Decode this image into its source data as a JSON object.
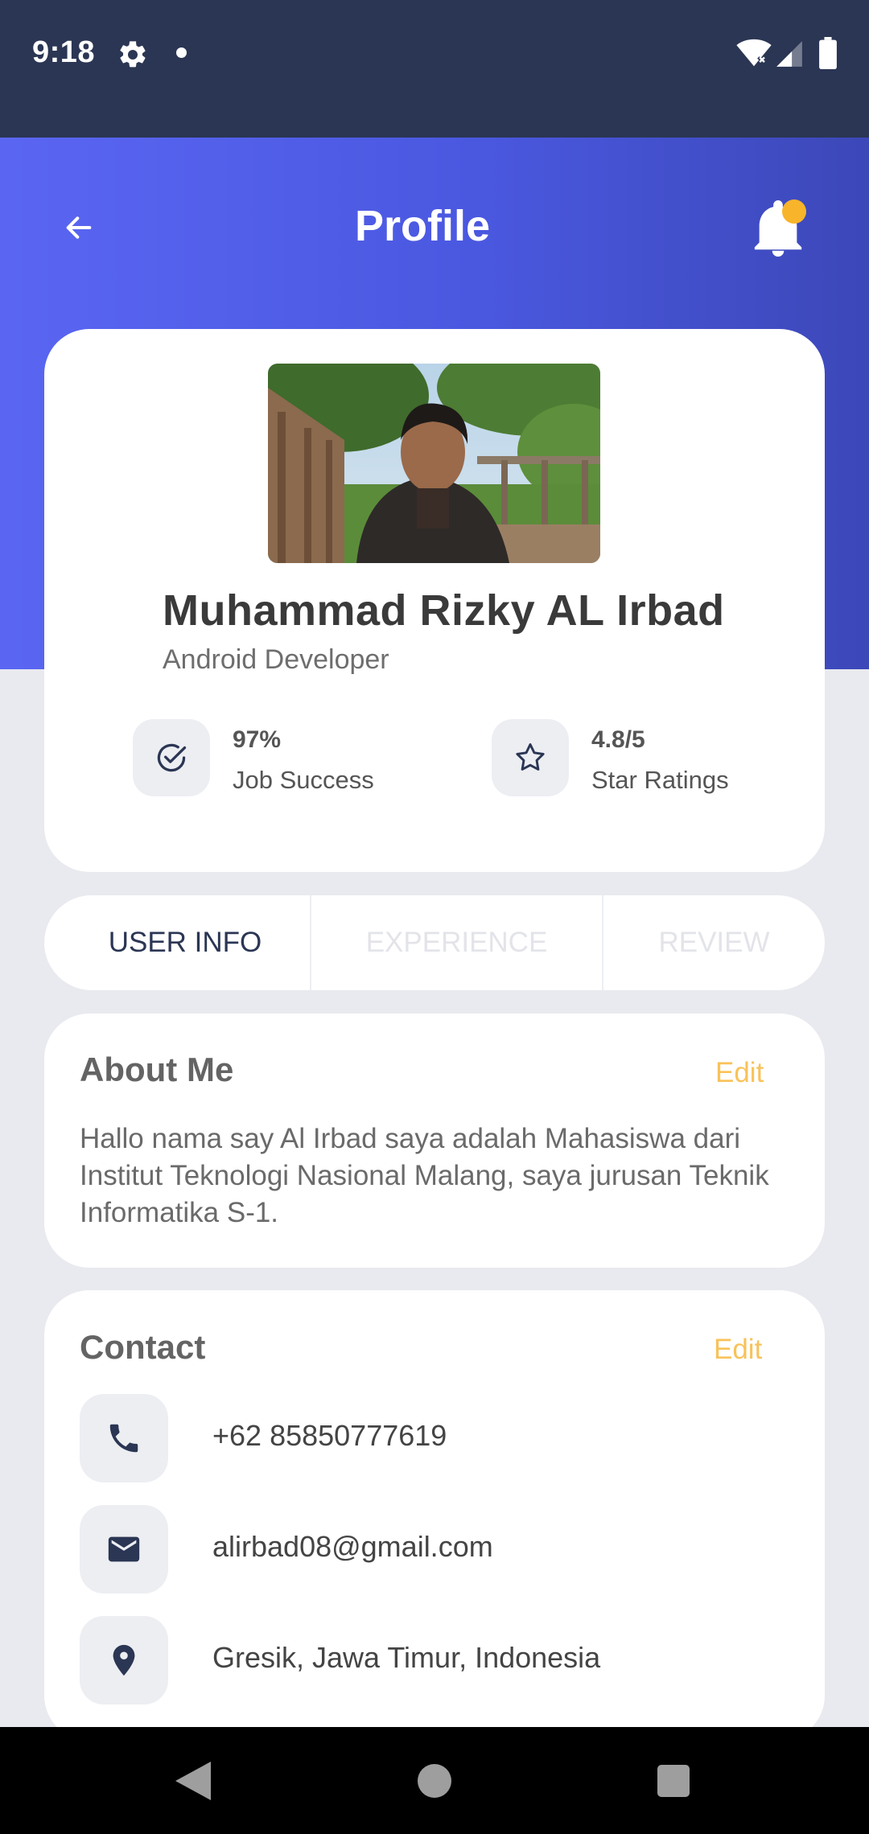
{
  "status_bar": {
    "time": "9:18",
    "icons": [
      "gear-icon",
      "notification-dot",
      "wifi-icon",
      "signal-icon",
      "battery-icon"
    ]
  },
  "header": {
    "title": "Profile",
    "icons": [
      "back-arrow-icon",
      "bell-icon"
    ],
    "gradient_colors": [
      "#5a66f2",
      "#3c48b8"
    ],
    "notification_badge_color": "#f8b42a"
  },
  "profile": {
    "name": "Muhammad Rizky AL Irbad",
    "role": "Android Developer",
    "stats": [
      {
        "value": "97%",
        "label": "Job Success",
        "icon": "check-circle-icon"
      },
      {
        "value": "4.8/5",
        "label": "Star Ratings",
        "icon": "star-icon"
      }
    ]
  },
  "tabs": [
    {
      "label": "USER INFO",
      "active": true
    },
    {
      "label": "EXPERIENCE",
      "active": false
    },
    {
      "label": "REVIEW",
      "active": false
    }
  ],
  "about": {
    "title": "About Me",
    "edit_label": "Edit",
    "text": "Hallo nama say Al Irbad saya adalah Mahasiswa dari Institut Teknologi Nasional Malang, saya jurusan Teknik Informatika S-1."
  },
  "contact": {
    "title": "Contact",
    "edit_label": "Edit",
    "items": [
      {
        "icon": "phone-icon",
        "text": "+62 85850777619"
      },
      {
        "icon": "mail-icon",
        "text": "alirbad08@gmail.com"
      },
      {
        "icon": "location-pin-icon",
        "text": "Gresik, Jawa Timur, Indonesia"
      }
    ]
  },
  "colors": {
    "primary_dark": "#2b3654",
    "accent": "#f8c25a",
    "card_background": "#ffffff",
    "page_background": "#e9eaef"
  }
}
